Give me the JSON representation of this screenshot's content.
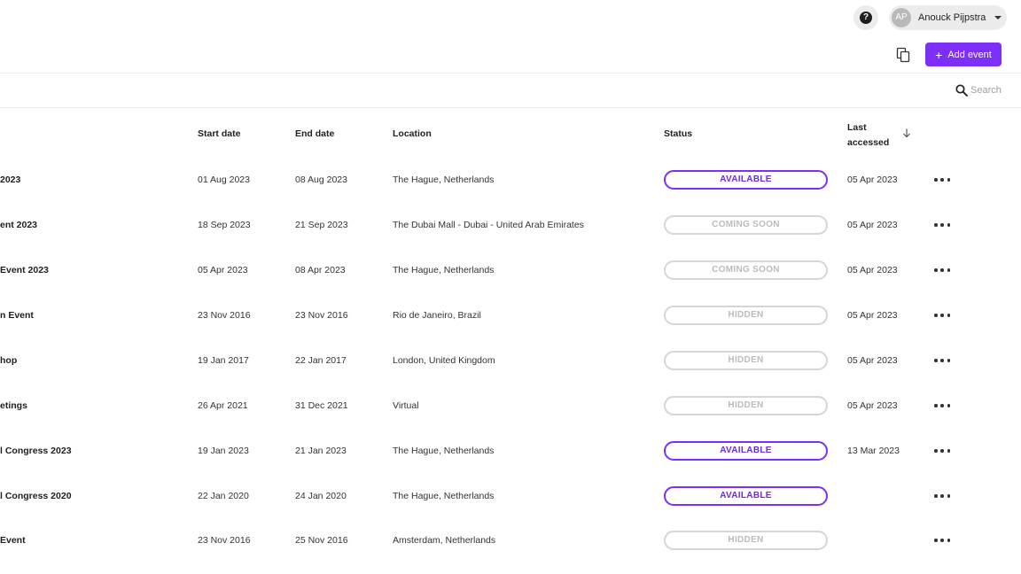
{
  "header": {
    "help_label": "?",
    "user": {
      "initials": "AP",
      "name": "Anouck Pijpstra"
    }
  },
  "toolbar": {
    "add_event_label": "Add event"
  },
  "search": {
    "placeholder": "Search"
  },
  "colors": {
    "accent": "#7b2ff7",
    "muted_badge": "#d6d6d6"
  },
  "table": {
    "columns": {
      "start": "Start date",
      "end": "End date",
      "location": "Location",
      "status": "Status",
      "last_accessed": "Last accessed"
    },
    "rows": [
      {
        "name": "2023",
        "start": "01 Aug 2023",
        "end": "08 Aug 2023",
        "location": "The Hague, Netherlands",
        "status": "AVAILABLE",
        "status_type": "available",
        "last": "05 Apr 2023"
      },
      {
        "name": "ent 2023",
        "start": "18 Sep 2023",
        "end": "21 Sep 2023",
        "location": "The Dubai Mall - Dubai - United Arab Emirates",
        "status": "COMING SOON",
        "status_type": "muted",
        "last": "05 Apr 2023"
      },
      {
        "name": " Event 2023",
        "start": "05 Apr 2023",
        "end": "08 Apr 2023",
        "location": "The Hague, Netherlands",
        "status": "COMING SOON",
        "status_type": "muted",
        "last": "05 Apr 2023"
      },
      {
        "name": "n Event",
        "start": "23 Nov 2016",
        "end": "23 Nov 2016",
        "location": "Rio de Janeiro, Brazil",
        "status": "HIDDEN",
        "status_type": "muted",
        "last": "05 Apr 2023"
      },
      {
        "name": "hop",
        "start": "19 Jan 2017",
        "end": "22 Jan 2017",
        "location": "London, United Kingdom",
        "status": "HIDDEN",
        "status_type": "muted",
        "last": "05 Apr 2023"
      },
      {
        "name": "etings",
        "start": "26 Apr 2021",
        "end": "31 Dec 2021",
        "location": "Virtual",
        "status": "HIDDEN",
        "status_type": "muted",
        "last": "05 Apr 2023"
      },
      {
        "name": "l Congress 2023",
        "start": "19 Jan 2023",
        "end": "21 Jan 2023",
        "location": "The Hague, Netherlands",
        "status": "AVAILABLE",
        "status_type": "available",
        "last": "13 Mar 2023"
      },
      {
        "name": "l Congress 2020",
        "start": "22 Jan 2020",
        "end": "24 Jan 2020",
        "location": "The Hague, Netherlands",
        "status": "AVAILABLE",
        "status_type": "available",
        "last": ""
      },
      {
        "name": "Event",
        "start": "23 Nov 2016",
        "end": "25 Nov 2016",
        "location": "Amsterdam, Netherlands",
        "status": "HIDDEN",
        "status_type": "muted",
        "last": ""
      }
    ]
  }
}
